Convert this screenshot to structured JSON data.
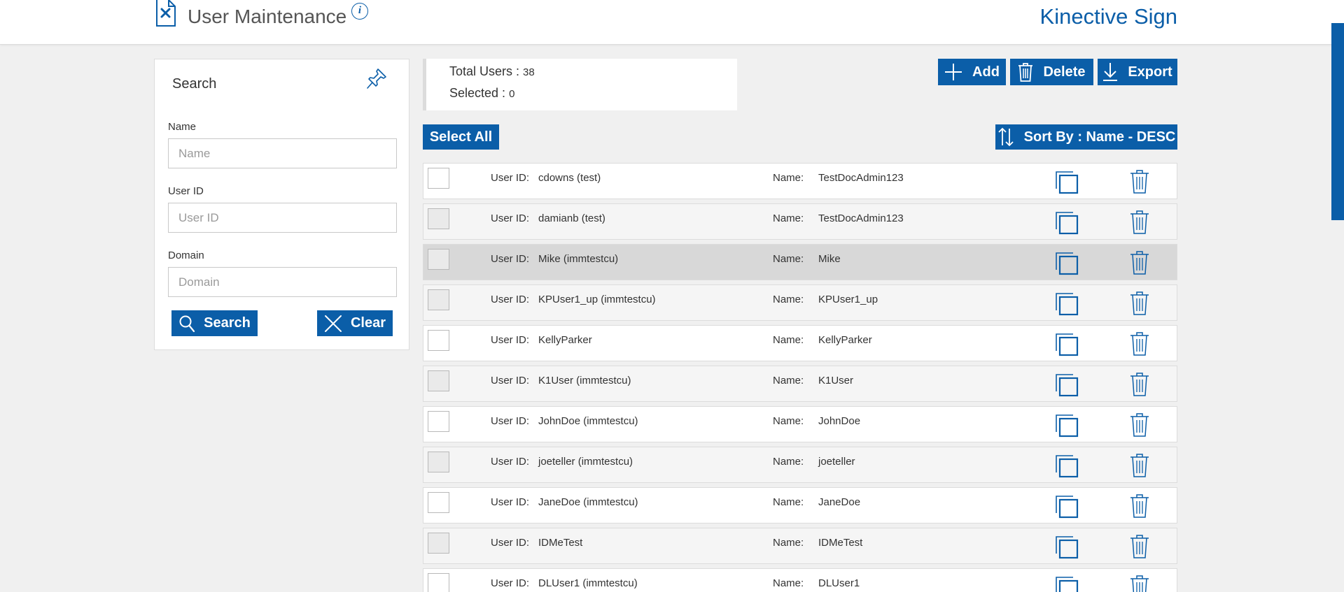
{
  "header": {
    "title": "User Maintenance",
    "info_glyph": "i",
    "brand": "Kinective Sign",
    "icons": {
      "page": "tools-document-icon",
      "info": "info-icon"
    }
  },
  "search": {
    "title": "Search",
    "name_label": "Name",
    "name_placeholder": "Name",
    "name_value": "",
    "userid_label": "User ID",
    "userid_placeholder": "User ID",
    "userid_value": "",
    "domain_label": "Domain",
    "domain_placeholder": "Domain",
    "domain_value": "",
    "search_button": "Search",
    "clear_button": "Clear"
  },
  "summary": {
    "total_label": "Total Users : ",
    "total_value": "38",
    "selected_label": "Selected : ",
    "selected_value": "0"
  },
  "toolbar": {
    "add": "Add",
    "delete": "Delete",
    "export": "Export",
    "select_all": "Select All",
    "sort": "Sort By : Name - DESC"
  },
  "colors": {
    "accent": "#0b5ea8",
    "background": "#f0f0f0",
    "row_highlight": "#d8d8d8"
  },
  "list": {
    "userid_key": "User ID:",
    "name_key": "Name:",
    "rows": [
      {
        "user_id": "cdowns (test)",
        "name": "TestDocAdmin123"
      },
      {
        "user_id": "damianb (test)",
        "name": "TestDocAdmin123"
      },
      {
        "user_id": "Mike (immtestcu)",
        "name": "Mike",
        "highlighted": true
      },
      {
        "user_id": "KPUser1_up (immtestcu)",
        "name": "KPUser1_up"
      },
      {
        "user_id": "KellyParker",
        "name": "KellyParker"
      },
      {
        "user_id": "K1User (immtestcu)",
        "name": "K1User"
      },
      {
        "user_id": "JohnDoe (immtestcu)",
        "name": "JohnDoe"
      },
      {
        "user_id": "joeteller (immtestcu)",
        "name": "joeteller"
      },
      {
        "user_id": "JaneDoe (immtestcu)",
        "name": "JaneDoe"
      },
      {
        "user_id": "IDMeTest",
        "name": "IDMeTest"
      },
      {
        "user_id": "DLUser1 (immtestcu)",
        "name": "DLUser1"
      }
    ]
  }
}
